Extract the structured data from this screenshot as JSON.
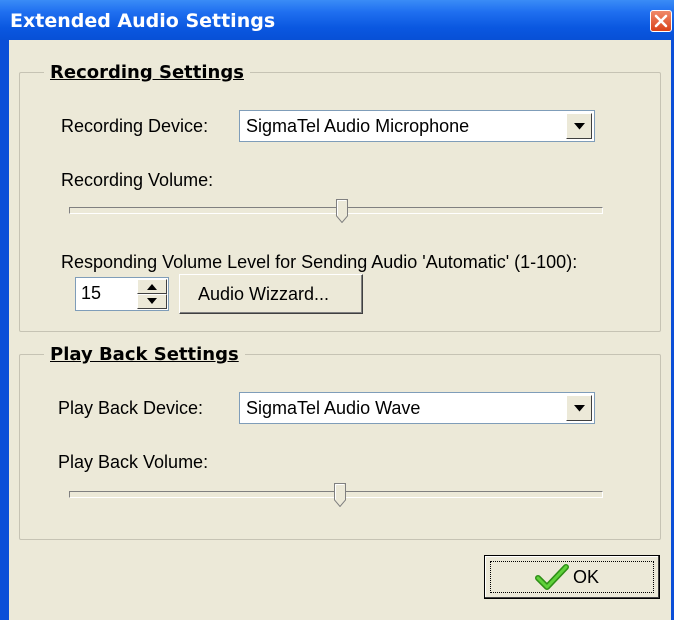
{
  "window": {
    "title": "Extended Audio Settings"
  },
  "recording": {
    "group_label": "Recording Settings",
    "device_label": "Recording Device:",
    "device_value": "SigmaTel Audio Microphone",
    "volume_label": "Recording Volume:",
    "volume_level": 0.5,
    "responding_label": "Responding Volume Level for Sending Audio 'Automatic' (1-100):",
    "responding_value": "15",
    "wizard_button": "Audio Wizzard..."
  },
  "playback": {
    "group_label": "Play Back Settings",
    "device_label": "Play Back Device:",
    "device_value": "SigmaTel Audio Wave",
    "volume_label": "Play Back Volume:",
    "volume_level": 0.5
  },
  "footer": {
    "ok_button": "OK"
  },
  "icons": {
    "close": "close-icon",
    "dropdown": "chevron-down-icon",
    "spinner": "spinner-arrows-icon",
    "ok": "checkmark-icon"
  },
  "colors": {
    "titlebar": "#0a57e0",
    "face": "#ece9d8",
    "checkmark": "#3aa51a",
    "close": "#d9421a"
  }
}
